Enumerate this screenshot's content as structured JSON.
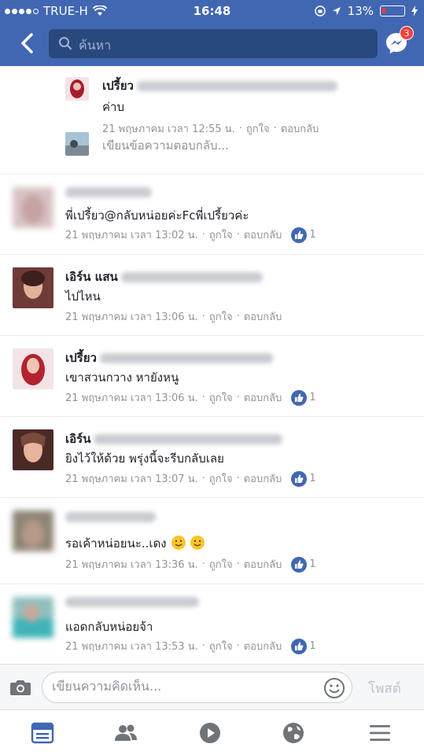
{
  "status_bar": {
    "carrier": "TRUE-H",
    "time": "16:48",
    "battery": "13%"
  },
  "header": {
    "search_placeholder": "ค้นหา",
    "messenger_badge": "3"
  },
  "comments": [
    {
      "name": "เปรี้ยว",
      "text": "ค่าบ",
      "date": "21 พฤษภาคม เวลา 12:55 น.",
      "like_label": "ถูกใจ",
      "reply_label": "ตอบกลับ",
      "likes": ""
    },
    {
      "reply_placeholder": "เขียนข้อความตอบกลับ..."
    },
    {
      "name": "",
      "text": "พี่เปรี้ยว@กลับหน่อยค่ะFcพี่เปรี้ยวค่ะ",
      "date": "21 พฤษภาคม เวลา 13:02 น.",
      "like_label": "ถูกใจ",
      "reply_label": "ตอบกลับ",
      "likes": "1"
    },
    {
      "name": "เอิร์น แสน",
      "text": "ไปไหน",
      "date": "21 พฤษภาคม เวลา 13:06 น.",
      "like_label": "ถูกใจ",
      "reply_label": "ตอบกลับ",
      "likes": ""
    },
    {
      "name": "เปรี้ยว",
      "text": "เขาสวนกวาง หายังหนู",
      "date": "21 พฤษภาคม เวลา 13:06 น.",
      "like_label": "ถูกใจ",
      "reply_label": "ตอบกลับ",
      "likes": "1"
    },
    {
      "name": "เอิร์น",
      "text": "ยิงไว้ให้ด้วย พรุ่งนี้จะรีบกลับเลย",
      "date": "21 พฤษภาคม เวลา 13:07 น.",
      "like_label": "ถูกใจ",
      "reply_label": "ตอบกลับ",
      "likes": "1"
    },
    {
      "name": "",
      "text": "รอเค้าหน่อยนะ..เดง",
      "date": "21 พฤษภาคม เวลา 13:36 น.",
      "like_label": "ถูกใจ",
      "reply_label": "ตอบกลับ",
      "likes": "1"
    },
    {
      "name": "",
      "text": "แอดกลับหน่อยจ้า",
      "date": "21 พฤษภาคม เวลา 13:53 น.",
      "like_label": "ถูกใจ",
      "reply_label": "ตอบกลับ",
      "likes": "1"
    }
  ],
  "composer": {
    "placeholder": "เขียนความคิดเห็น...",
    "post_label": "โพสต์"
  },
  "tabs": [
    "news-feed",
    "friends",
    "watch",
    "notifications",
    "menu"
  ],
  "colors": {
    "brand_blue": "#4267b2",
    "search_bg": "#29487d",
    "meta_gray": "#90949c"
  }
}
